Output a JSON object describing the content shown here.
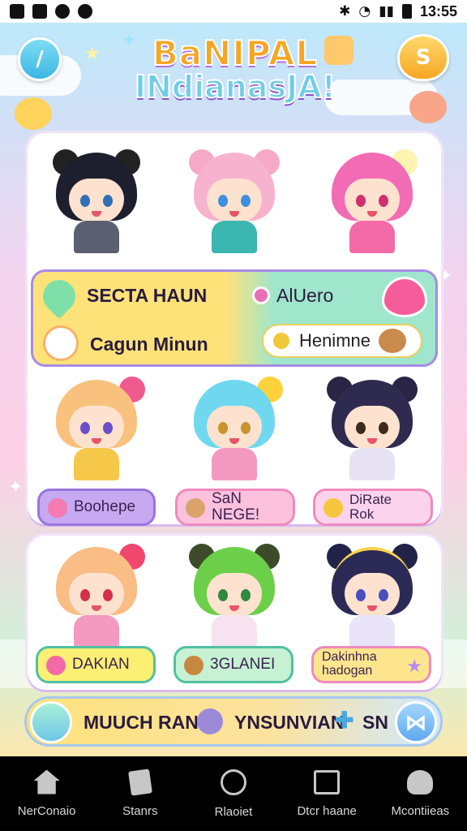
{
  "status_bar": {
    "time": "13:55"
  },
  "header": {
    "title_line1": "BaNIPAL",
    "title_line2": "INdianasJA!",
    "coin_label": "S",
    "back_label": "/"
  },
  "info_strip": {
    "left_title": "SECTA HAUN",
    "left_sub": "Cagun Minun",
    "right_title": "AlUero",
    "right_pill": "Henimne"
  },
  "row2_tags": [
    "Boohepe",
    "SaN NEGE!",
    "DiRate Rok"
  ],
  "row3_tags": [
    "DAKIAN",
    "3GLANEI",
    "Dakinhna hadogan"
  ],
  "action_bar": {
    "left_text": "MUUCH RANG",
    "mid_text": "YNSUNVIAN",
    "right_text": "SN"
  },
  "bottom_nav": [
    {
      "label": "NerConaio",
      "icon": "home-icon"
    },
    {
      "label": "Stanrs",
      "icon": "cards-icon"
    },
    {
      "label": "Rlaoiet",
      "icon": "compass-icon"
    },
    {
      "label": "Dtcr haane",
      "icon": "tv-icon"
    },
    {
      "label": "Mcontiieas",
      "icon": "profile-icon"
    }
  ],
  "colors": {
    "accent_yellow": "#fde27a",
    "accent_mint": "#9fe6cc",
    "accent_purple": "#a78ae6",
    "accent_pink": "#f78fbf"
  }
}
